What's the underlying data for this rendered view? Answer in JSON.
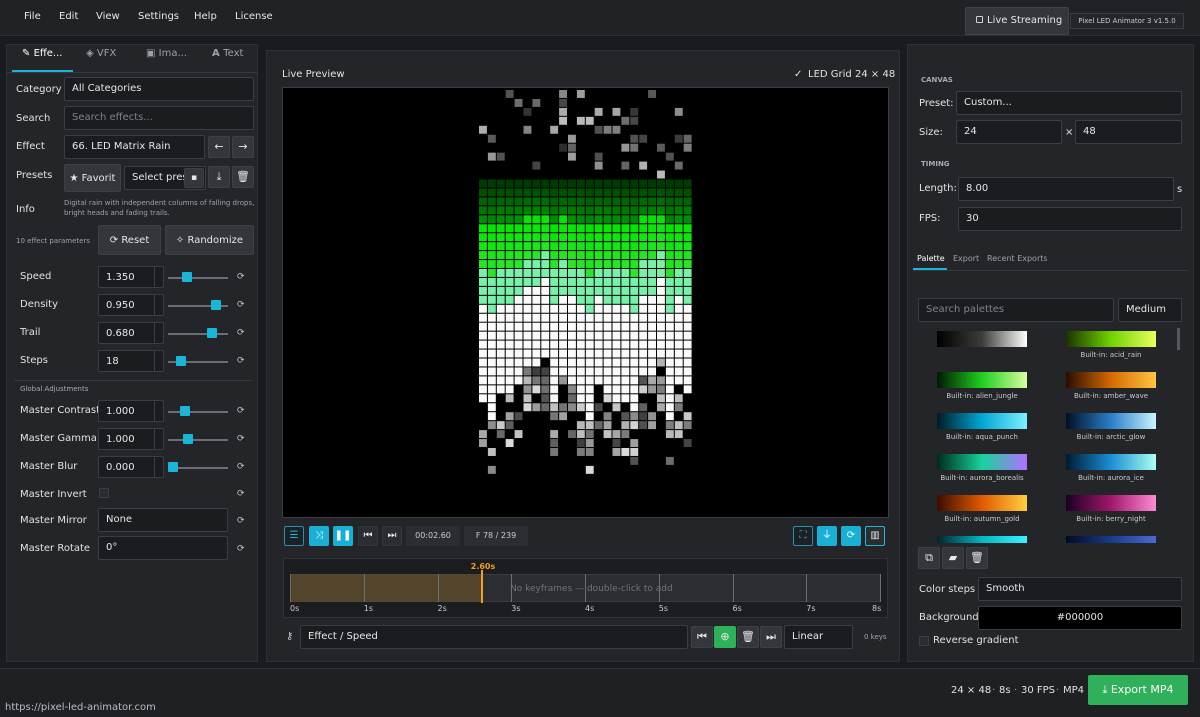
{
  "menu": [
    "File",
    "Edit",
    "View",
    "Settings",
    "Help",
    "License"
  ],
  "header": {
    "live_streaming": "Live Streaming",
    "version": "Pixel LED Animator 3  v1.5.0"
  },
  "left_tabs": [
    "Effe...",
    "VFX",
    "Ima...",
    "Text"
  ],
  "effects": {
    "category_label": "Category",
    "category_value": "All Categories",
    "search_label": "Search",
    "search_placeholder": "Search effects...",
    "effect_label": "Effect",
    "effect_value": "66. LED Matrix Rain",
    "presets_label": "Presets",
    "favorit": "Favorit",
    "select_preset": "Select prese",
    "info_label": "Info",
    "info_text": "Digital rain with independent columns of falling drops, bright heads and fading trails.",
    "param_count": "10 effect parameters",
    "reset": "Reset",
    "randomize": "Randomize",
    "params": [
      {
        "label": "Speed",
        "value": "1.350",
        "level": 0.27
      },
      {
        "label": "Density",
        "value": "0.950",
        "level": 0.85
      },
      {
        "label": "Trail",
        "value": "0.680",
        "level": 0.78
      },
      {
        "label": "Steps",
        "value": "18",
        "level": 0.16
      }
    ],
    "global_heading": "Global Adjustments",
    "global": [
      {
        "label": "Master Contrast",
        "value": "1.000",
        "level": 0.23
      },
      {
        "label": "Master Gamma",
        "value": "1.000",
        "level": 0.3
      },
      {
        "label": "Master Blur",
        "value": "0.000",
        "level": 0.0
      }
    ],
    "invert_label": "Master Invert",
    "mirror_label": "Master Mirror",
    "mirror_value": "None",
    "rotate_label": "Master Rotate",
    "rotate_value": "0°"
  },
  "preview": {
    "title": "Live Preview",
    "grid_label": "LED Grid",
    "grid_size": "24 × 48",
    "time": "00:02.60",
    "frame": "F  78 / 239"
  },
  "timeline": {
    "playhead": "2.60s",
    "empty_text": "No keyframes — double-click to add",
    "ticks": [
      "0s",
      "1s",
      "2s",
      "3s",
      "4s",
      "5s",
      "6s",
      "7s",
      "8s"
    ],
    "playhead_time_s": 2.6,
    "track": "Effect / Speed",
    "interp": "Linear",
    "keys": "0 keys"
  },
  "canvas": {
    "heading": "CANVAS",
    "preset_label": "Preset:",
    "preset_value": "Custom...",
    "size_label": "Size:",
    "width": "24",
    "times": "×",
    "height": "48",
    "timing_heading": "TIMING",
    "length_label": "Length:",
    "length_value": "8.00",
    "length_unit": "s",
    "fps_label": "FPS:",
    "fps_value": "30"
  },
  "right_tabs": [
    "Palette",
    "Export",
    "Recent Exports"
  ],
  "palette": {
    "search_placeholder": "Search palettes",
    "size": "Medium",
    "items": [
      {
        "name": "",
        "colors": [
          "#000000",
          "#3c3c3c",
          "#ffffff"
        ]
      },
      {
        "name": "Built-in: acid_rain",
        "colors": [
          "#1a3300",
          "#6fd400",
          "#e8ff5a"
        ]
      },
      {
        "name": "Built-in: alien_jungle",
        "colors": [
          "#001a00",
          "#1fcf1f",
          "#d8ffa0"
        ]
      },
      {
        "name": "Built-in: amber_wave",
        "colors": [
          "#2a0d00",
          "#d46a00",
          "#ffc640"
        ]
      },
      {
        "name": "Built-in: aqua_punch",
        "colors": [
          "#001a26",
          "#00a8d4",
          "#7df0ff"
        ]
      },
      {
        "name": "Built-in: arctic_glow",
        "colors": [
          "#001024",
          "#2a7fc8",
          "#c8f4ff"
        ]
      },
      {
        "name": "Built-in: aurora_borealis",
        "colors": [
          "#00291f",
          "#18d49a",
          "#b070ff"
        ]
      },
      {
        "name": "Built-in: aurora_ice",
        "colors": [
          "#001a33",
          "#1a8fd4",
          "#aafff0"
        ]
      },
      {
        "name": "Built-in: autumn_gold",
        "colors": [
          "#3a0d00",
          "#e05a00",
          "#ffd040"
        ]
      },
      {
        "name": "Built-in: berry_night",
        "colors": [
          "#1a0022",
          "#a0186a",
          "#ff8ad4"
        ]
      },
      {
        "name": "",
        "colors": [
          "#00262a",
          "#00b8c4",
          "#40f0ff"
        ]
      },
      {
        "name": "",
        "colors": [
          "#000a26",
          "#1a3a8a",
          "#4a6ad4"
        ]
      }
    ],
    "color_steps_label": "Color steps",
    "color_steps_value": "Smooth",
    "background_label": "Background",
    "background_value": "#000000",
    "reverse_label": "Reverse gradient"
  },
  "status": {
    "grid": "24 × 48",
    "length": "8s",
    "fps": "30 FPS",
    "format": "MP4",
    "export": "Export MP4",
    "url": "https://pixel-led-animator.com"
  }
}
